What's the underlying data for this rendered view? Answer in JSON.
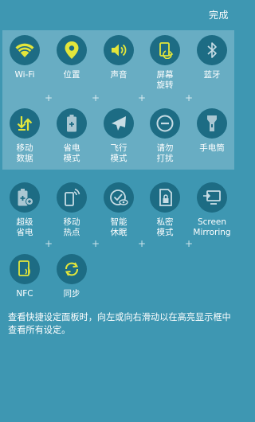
{
  "header": {
    "done_label": "完成"
  },
  "active_tiles": [
    {
      "label": "Wi-Fi",
      "icon": "wifi-icon"
    },
    {
      "label": "位置",
      "icon": "location-pin-icon"
    },
    {
      "label": "声音",
      "icon": "sound-icon"
    },
    {
      "label": "屏幕\n旋转",
      "icon": "screen-rotation-icon"
    },
    {
      "label": "蓝牙",
      "icon": "bluetooth-icon"
    },
    {
      "label": "移动\n数据",
      "icon": "mobile-data-icon"
    },
    {
      "label": "省电\n模式",
      "icon": "battery-saver-icon"
    },
    {
      "label": "飞行\n模式",
      "icon": "airplane-icon"
    },
    {
      "label": "请勿\n打扰",
      "icon": "do-not-disturb-icon"
    },
    {
      "label": "手电筒",
      "icon": "flashlight-icon"
    }
  ],
  "inactive_tiles": [
    {
      "label": "超级\n省电",
      "icon": "ultra-power-saving-icon"
    },
    {
      "label": "移动\n热点",
      "icon": "mobile-hotspot-icon"
    },
    {
      "label": "智能\n休眠",
      "icon": "smart-stay-icon"
    },
    {
      "label": "私密\n模式",
      "icon": "private-mode-icon"
    },
    {
      "label": "Screen\nMirroring",
      "icon": "screen-mirroring-icon"
    },
    {
      "label": "NFC",
      "icon": "nfc-icon"
    },
    {
      "label": "同步",
      "icon": "sync-icon"
    }
  ],
  "help_text": "查看快捷设定面板时，向左或向右滑动以在高亮显示框中查看所有设定。",
  "colors": {
    "background": "#3e97b2",
    "icon_circle": "#1d6c84",
    "icon_accent": "#e3e63b"
  }
}
